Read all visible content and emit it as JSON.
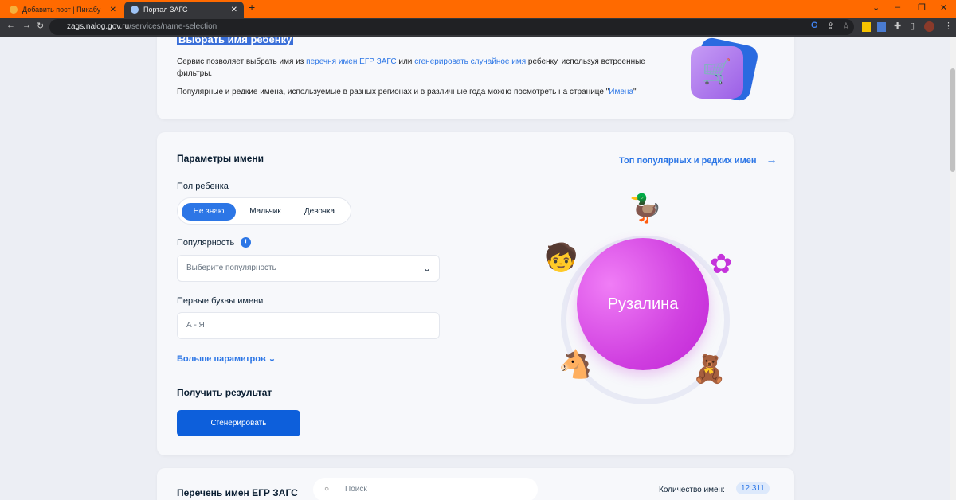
{
  "browser": {
    "tabs": [
      {
        "title": "Добавить пост | Пикабу"
      },
      {
        "title": "Портал ЗАГС"
      }
    ],
    "url_host": "zags.nalog.gov.ru",
    "url_path": "/services/name-selection"
  },
  "intro": {
    "title": "Выбрать имя ребенку",
    "p1_a": "Сервис позволяет выбрать имя из ",
    "p1_link1": "перечня имен ЕГР ЗАГС",
    "p1_b": " или ",
    "p1_link2": "сгенерировать случайное имя",
    "p1_c": " ребенку, используя встроенные фильтры.",
    "p2_a": "Популярные и редкие имена, используемые в разных регионах и в различные года можно посмотреть на странице \"",
    "p2_link": "Имена",
    "p2_b": "\""
  },
  "params": {
    "title": "Параметры имени",
    "top_link": "Топ популярных и редких имен",
    "gender_label": "Пол ребенка",
    "gender_options": [
      "Не знаю",
      "Мальчик",
      "Девочка"
    ],
    "popularity_label": "Популярность",
    "popularity_placeholder": "Выберите популярность",
    "letters_label": "Первые буквы имени",
    "letters_placeholder": "А - Я",
    "more": "Больше параметров",
    "result_label": "Получить результат",
    "generate": "Сгенерировать",
    "generated_name": "Рузалина"
  },
  "list": {
    "title": "Перечень имен ЕГР ЗАГС",
    "search_placeholder": "Поиск",
    "count_label": "Количество имен:",
    "count": "12 311"
  }
}
